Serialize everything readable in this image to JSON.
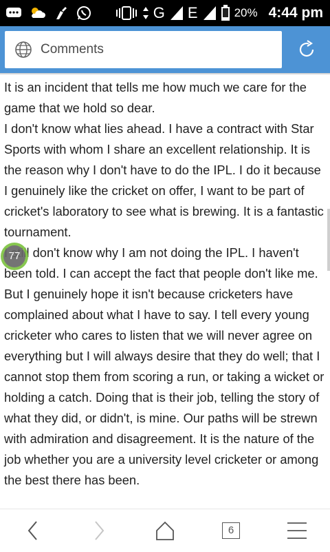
{
  "status_bar": {
    "network_label": "G",
    "network_label_2": "E",
    "battery_percent": "20%",
    "time": "4:44 pm"
  },
  "toolbar": {
    "page_title": "Comments",
    "accent_color": "#4d93d5"
  },
  "article": {
    "paragraphs": [
      "It is an incident that tells me how much we care for the game that we hold so dear.",
      "I don't know what lies ahead. I have a contract with Star Sports with whom I share an excellent relationship. It is the reason why I don't have to do the IPL. I do it because I genuinely like the cricket on offer, I want to be part of cricket's laboratory to see what is brewing. It is a fantastic tournament.",
      "I still don't know why I am not doing the IPL. I haven't been told. I can accept the fact that people don't like me. But I genuinely hope it isn't because cricketers have complained about what I have to say. I tell every young cricketer who cares to listen that we will never agree on everything but I will always desire that they do well; that I cannot stop them from scoring a run, or taking a wicket or holding a catch. Doing that is their job, telling the story of what they did, or didn't, is mine. Our paths will be strewn with admiration and disagreement. It is the nature of the job whether you are a university level cricketer or among the best there has been."
    ]
  },
  "badge": {
    "value": "77"
  },
  "bottom_nav": {
    "tab_count": "6"
  }
}
